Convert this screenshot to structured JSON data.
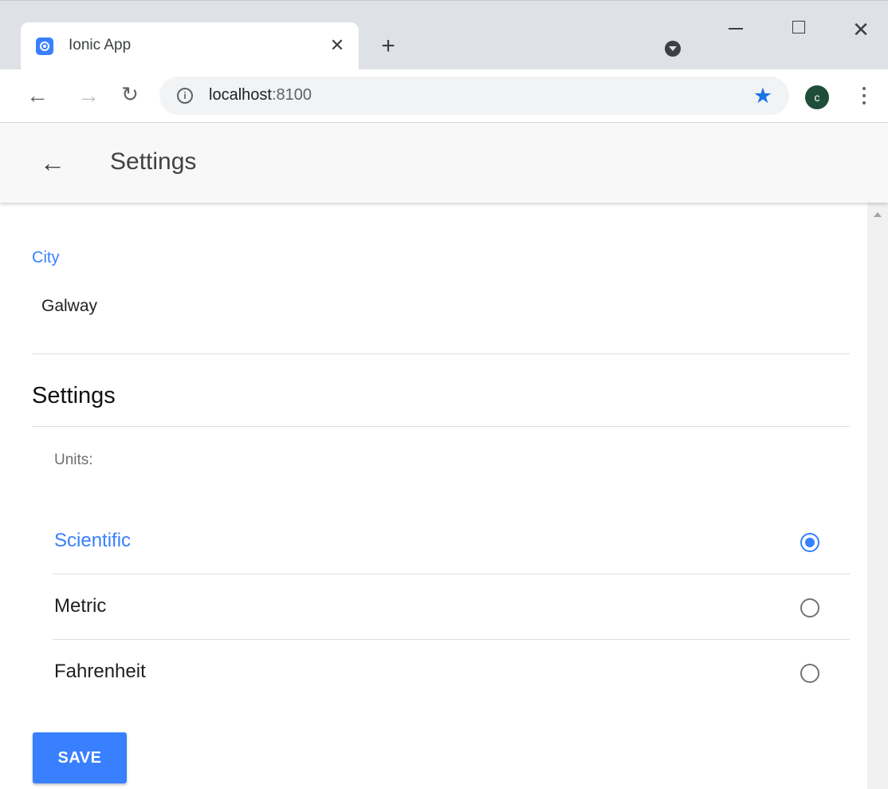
{
  "browser": {
    "tab": {
      "title": "Ionic App",
      "close_glyph": "✕"
    },
    "new_tab_glyph": "+",
    "window_close_glyph": "✕",
    "nav": {
      "back_glyph": "←",
      "forward_glyph": "→",
      "reload_glyph": "↻"
    },
    "address": {
      "info_glyph": "i",
      "host": "localhost",
      "port": ":8100"
    },
    "bookmark_glyph": "★",
    "profile_initial": "c"
  },
  "header": {
    "back_glyph": "←",
    "title": "Settings"
  },
  "form": {
    "city_label": "City",
    "city_value": "Galway",
    "section_title": "Settings",
    "units_label": "Units:",
    "options": [
      {
        "label": "Scientific",
        "selected": true
      },
      {
        "label": "Metric",
        "selected": false
      },
      {
        "label": "Fahrenheit",
        "selected": false
      }
    ],
    "save_label": "SAVE"
  },
  "colors": {
    "primary": "#3880ff",
    "profile": "#1e4d3a",
    "bookmark": "#1a73e8"
  }
}
